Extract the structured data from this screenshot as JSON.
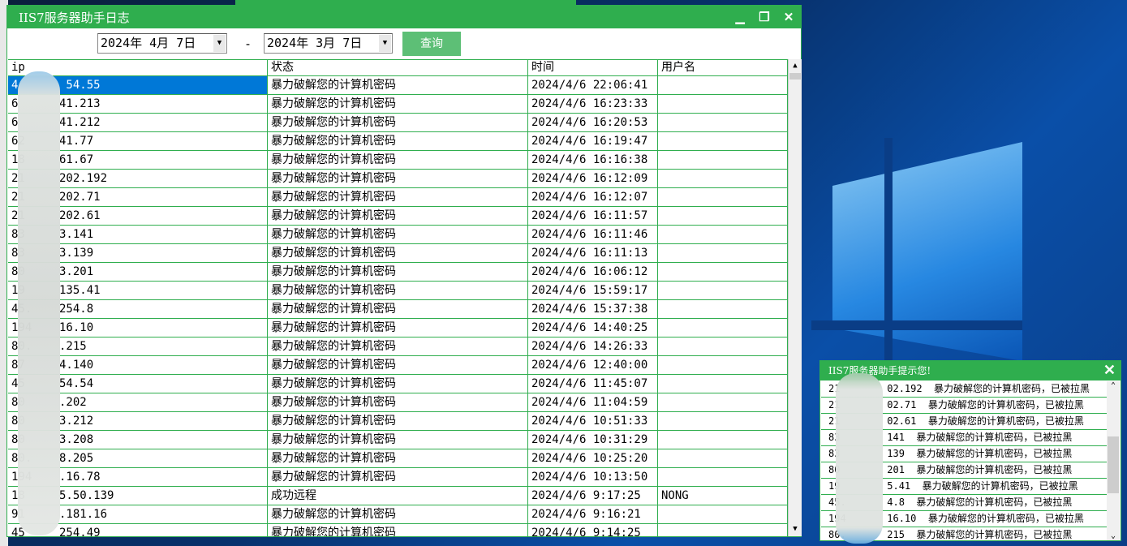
{
  "window": {
    "title": "IIS7服务器助手日志",
    "minimize": "▁",
    "restore": "❐",
    "close": "✕"
  },
  "toolbar": {
    "date_from": "2024年  4月  7日",
    "date_to": "2024年  3月  7日",
    "dash": "-",
    "query_label": "查询"
  },
  "table": {
    "columns": [
      "ip",
      "状态",
      "时间",
      "用户名"
    ],
    "rows": [
      [
        "4       54.55",
        "暴力破解您的计算机密码",
        "2024/4/6 22:06:41",
        ""
      ],
      [
        "6      41.213",
        "暴力破解您的计算机密码",
        "2024/4/6 16:23:33",
        ""
      ],
      [
        "6      41.212",
        "暴力破解您的计算机密码",
        "2024/4/6 16:20:53",
        ""
      ],
      [
        "62     41.77",
        "暴力破解您的计算机密码",
        "2024/4/6 16:19:47",
        ""
      ],
      [
        "18     61.67",
        "暴力破解您的计算机密码",
        "2024/4/6 16:16:38",
        ""
      ],
      [
        "21     202.192",
        "暴力破解您的计算机密码",
        "2024/4/6 16:12:09",
        ""
      ],
      [
        "21     202.71",
        "暴力破解您的计算机密码",
        "2024/4/6 16:12:07",
        ""
      ],
      [
        "21     202.61",
        "暴力破解您的计算机密码",
        "2024/4/6 16:11:57",
        ""
      ],
      [
        "83     3.141",
        "暴力破解您的计算机密码",
        "2024/4/6 16:11:46",
        ""
      ],
      [
        "83     3.139",
        "暴力破解您的计算机密码",
        "2024/4/6 16:11:13",
        ""
      ],
      [
        "80     3.201",
        "暴力破解您的计算机密码",
        "2024/4/6 16:06:12",
        ""
      ],
      [
        "19     135.41",
        "暴力破解您的计算机密码",
        "2024/4/6 15:59:17",
        ""
      ],
      [
        "45.    254.8",
        "暴力破解您的计算机密码",
        "2024/4/6 15:37:38",
        ""
      ],
      [
        "194    16.10",
        "暴力破解您的计算机密码",
        "2024/4/6 14:40:25",
        ""
      ],
      [
        "80.    .215",
        "暴力破解您的计算机密码",
        "2024/4/6 14:26:33",
        ""
      ],
      [
        "87     4.140",
        "暴力破解您的计算机密码",
        "2024/4/6 12:40:00",
        ""
      ],
      [
        "45     54.54",
        "暴力破解您的计算机密码",
        "2024/4/6 11:45:07",
        ""
      ],
      [
        "80     .202",
        "暴力破解您的计算机密码",
        "2024/4/6 11:04:59",
        ""
      ],
      [
        "80     3.212",
        "暴力破解您的计算机密码",
        "2024/4/6 10:51:33",
        ""
      ],
      [
        "80     3.208",
        "暴力破解您的计算机密码",
        "2024/4/6 10:31:29",
        ""
      ],
      [
        "80.    8.205",
        "暴力破解您的计算机密码",
        "2024/4/6 10:25:20",
        ""
      ],
      [
        "194    .16.78",
        "暴力破解您的计算机密码",
        "2024/4/6 10:13:50",
        ""
      ],
      [
        "18     5.50.139",
        "成功远程",
        "2024/4/6 9:17:25",
        "NONG"
      ],
      [
        "91     .181.16",
        "暴力破解您的计算机密码",
        "2024/4/6 9:16:21",
        ""
      ],
      [
        "45     254.49",
        "暴力破解您的计算机密码",
        "2024/4/6 9:14:25",
        ""
      ]
    ]
  },
  "popup": {
    "title": "IIS7服务器助手提示您!",
    "close": "✕",
    "items": [
      "21        02.192  暴力破解您的计算机密码，已被拉黑",
      "21        02.71  暴力破解您的计算机密码，已被拉黑",
      "21        02.61  暴力破解您的计算机密码，已被拉黑",
      "83        141  暴力破解您的计算机密码，已被拉黑",
      "83        139  暴力破解您的计算机密码，已被拉黑",
      "80        201  暴力破解您的计算机密码，已被拉黑",
      "19        5.41  暴力破解您的计算机密码，已被拉黑",
      "45.       4.8  暴力破解您的计算机密码，已被拉黑",
      "194       16.10  暴力破解您的计算机密码，已被拉黑",
      "80.       215  暴力破解您的计算机密码，已被拉黑"
    ]
  }
}
